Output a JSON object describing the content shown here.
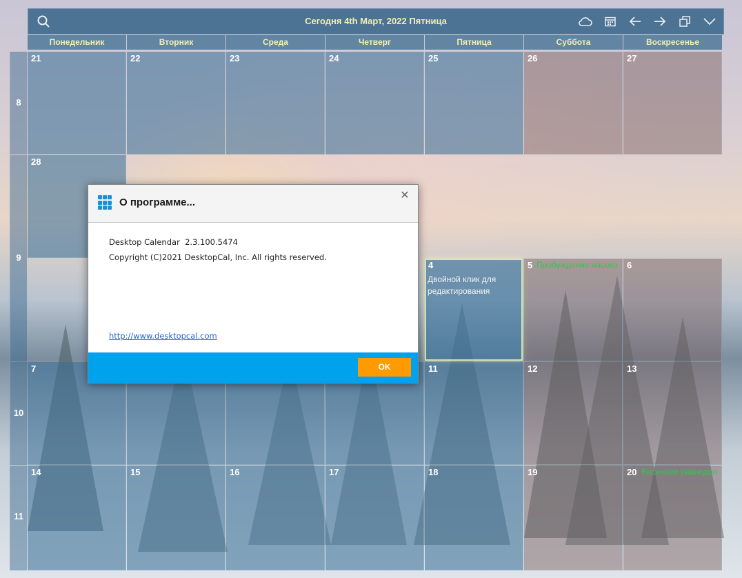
{
  "topbar": {
    "title": "Сегодня 4th Март, 2022 Пятница",
    "icons": [
      "search-icon",
      "cloud-icon",
      "calendar-icon",
      "arrow-left-icon",
      "arrow-right-icon",
      "restore-window-icon",
      "chevron-down-icon"
    ]
  },
  "weekdays": [
    "Понедельник",
    "Вторник",
    "Среда",
    "Четверг",
    "Пятница",
    "Суббота",
    "Воскресенье"
  ],
  "weeks": [
    {
      "label": "8",
      "days": [
        "21",
        "22",
        "23",
        "24",
        "25",
        "26",
        "27"
      ]
    },
    {
      "label": "9",
      "days": [
        "28",
        "",
        "",
        "",
        "4",
        "5",
        "6"
      ]
    },
    {
      "label": "10",
      "days": [
        "7",
        "",
        "",
        "",
        "11",
        "12",
        "13"
      ]
    },
    {
      "label": "11",
      "days": [
        "14",
        "15",
        "16",
        "17",
        "18",
        "19",
        "20"
      ]
    }
  ],
  "events": {
    "mar5": "Пробуждение насеко",
    "mar20": "Весеннее равноден"
  },
  "today_hint": "Двойной клик для редактирования",
  "dialog": {
    "title": "О программе...",
    "version_line": "Desktop Calendar  2.3.100.5474",
    "copyright_line": "Copyright (C)2021 DesktopCal, Inc. All rights reserved.",
    "link": "http://www.desktopcal.com",
    "ok_label": "OK"
  },
  "colors": {
    "accent_blue": "#00a2ee",
    "ok_orange": "#ff9a00",
    "header_text": "#f4efb0",
    "event_green": "#2fc84a"
  }
}
